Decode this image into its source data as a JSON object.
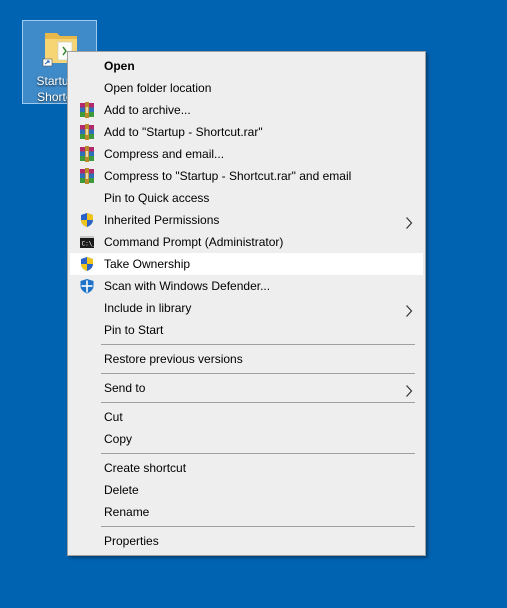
{
  "desktop": {
    "icon_label": "Startup - Shortcut"
  },
  "menu": {
    "open": "Open",
    "open_folder_location": "Open folder location",
    "add_to_archive": "Add to archive...",
    "add_to_rar": "Add to \"Startup - Shortcut.rar\"",
    "compress_email": "Compress and email...",
    "compress_rar_email": "Compress to \"Startup - Shortcut.rar\" and email",
    "pin_quick_access": "Pin to Quick access",
    "inherited_permissions": "Inherited Permissions",
    "command_prompt": "Command Prompt (Administrator)",
    "take_ownership": "Take Ownership",
    "scan_defender": "Scan with Windows Defender...",
    "include_library": "Include in library",
    "pin_start": "Pin to Start",
    "restore_versions": "Restore previous versions",
    "send_to": "Send to",
    "cut": "Cut",
    "copy": "Copy",
    "create_shortcut": "Create shortcut",
    "delete": "Delete",
    "rename": "Rename",
    "properties": "Properties"
  },
  "icons": {
    "archive": "winrar-icon",
    "shield": "uac-shield-icon",
    "cmd": "command-prompt-icon",
    "defender": "windows-defender-icon",
    "folder": "folder-icon",
    "submenu": "chevron-right-icon"
  },
  "colors": {
    "desktop_background": "#0063b1",
    "menu_background": "#eeeeee",
    "highlight": "#ffffff"
  }
}
